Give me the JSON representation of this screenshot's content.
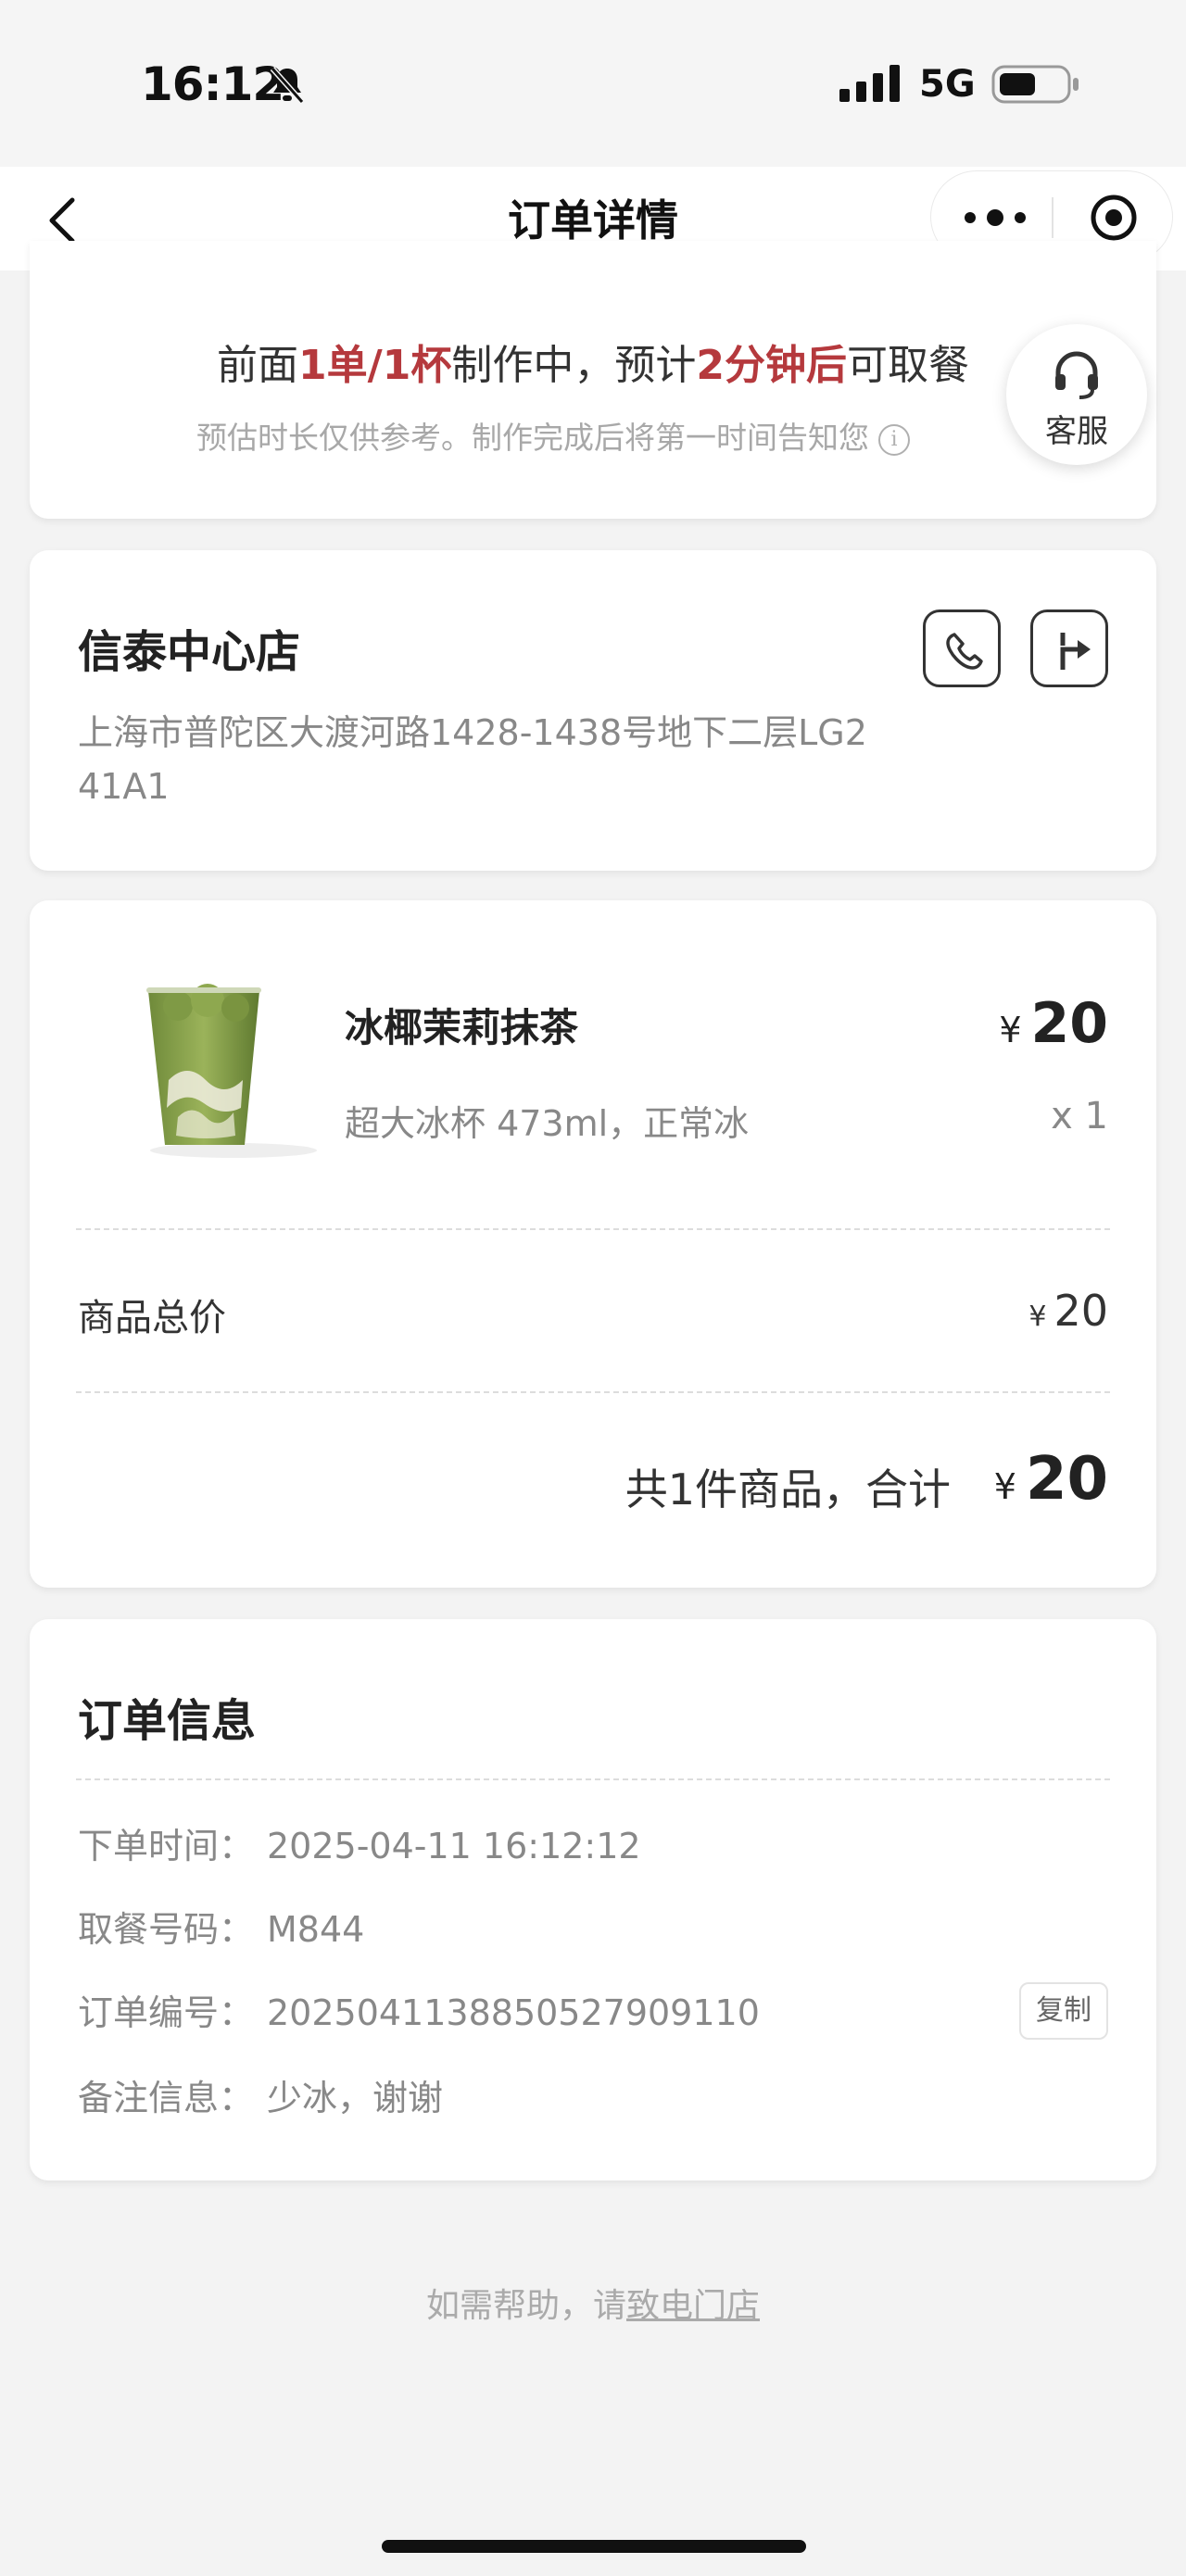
{
  "status_bar": {
    "time": "16:12",
    "network": "5G"
  },
  "nav": {
    "title": "订单详情"
  },
  "wait": {
    "prefix": "前面",
    "queue": "1单/1杯",
    "middle": "制作中，预计",
    "eta": "2分钟后",
    "suffix": "可取餐",
    "note": "预估时长仅供参考。制作完成后将第一时间告知您",
    "highlight_color": "#b5393d"
  },
  "customer_service": {
    "label": "客服"
  },
  "store": {
    "name": "信泰中心店",
    "address": "上海市普陀区大渡河路1428-1438号地下二层LG2 41A1"
  },
  "product": {
    "name": "冰椰茉莉抹茶",
    "spec": "超大冰杯 473ml，正常冰",
    "currency": "¥",
    "price": "20",
    "qty": "x 1"
  },
  "summary": {
    "subtotal_label": "商品总价",
    "subtotal_value": "20",
    "total_label": "共1件商品，合计",
    "total_value": "20"
  },
  "order_info": {
    "title": "订单信息",
    "rows": [
      {
        "label": "下单时间：",
        "value": "2025-04-11 16:12:12"
      },
      {
        "label": "取餐号码：",
        "value": "M844"
      },
      {
        "label": "订单编号：",
        "value": "2025041138850527909110"
      },
      {
        "label": "备注信息：",
        "value": "少冰，谢谢"
      }
    ],
    "copy_label": "复制"
  },
  "help": {
    "prefix": "如需帮助，请",
    "link": "致电门店"
  }
}
